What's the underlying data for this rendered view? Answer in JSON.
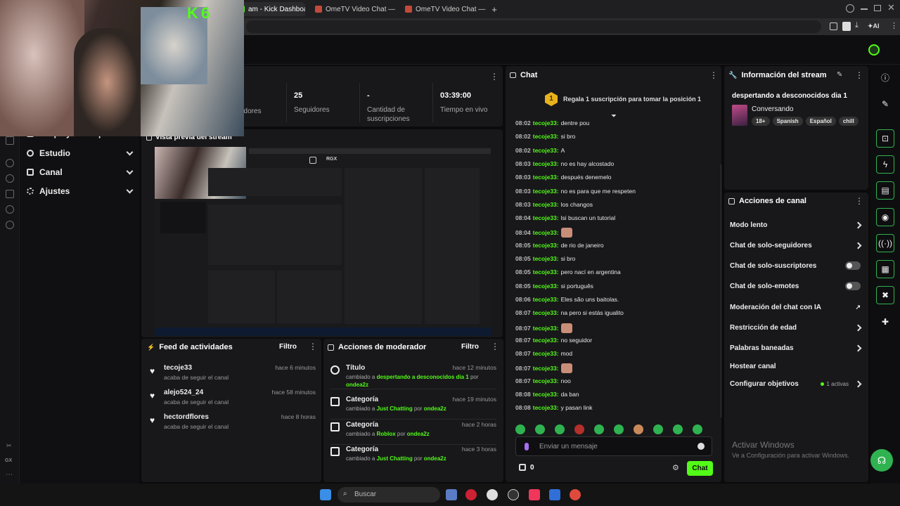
{
  "browser": {
    "tabs": [
      {
        "label": "am - Kick Dashboard",
        "active": true
      },
      {
        "label": "OmeTV Video Chat — Ome",
        "active": false
      },
      {
        "label": "OmeTV Video Chat — Ome",
        "active": false
      }
    ],
    "new_tab": "+",
    "ai_label": "AI"
  },
  "webcam": {
    "logo": "K 6"
  },
  "sidebar": {
    "items": [
      {
        "label": "Drops y recompensas",
        "icon": "gift-icon"
      },
      {
        "label": "Estudio",
        "icon": "studio-icon"
      },
      {
        "label": "Canal",
        "icon": "channel-icon"
      },
      {
        "label": "Ajustes",
        "icon": "settings-icon"
      }
    ],
    "bottom_labels": [
      "GX"
    ]
  },
  "stats": {
    "items": [
      {
        "value": "",
        "label": "adores"
      },
      {
        "value": "25",
        "label": "Seguidores"
      },
      {
        "value": "-",
        "label": "Cantidad de suscripciones"
      },
      {
        "value": "03:39:00",
        "label": "Tiempo en vivo"
      }
    ]
  },
  "preview": {
    "title": "Vista previa del stream",
    "badge": "RGX"
  },
  "feed": {
    "title": "Feed de actividades",
    "filter": "Filtro",
    "items": [
      {
        "name": "tecoje33",
        "sub": "acaba de seguir el canal",
        "time": "hace 6 minutos"
      },
      {
        "name": "alejo524_24",
        "sub": "acaba de seguir el canal",
        "time": "hace 58 minutos"
      },
      {
        "name": "hectordflores",
        "sub": "acaba de seguir el canal",
        "time": "hace 8 horas"
      }
    ]
  },
  "mod": {
    "title": "Acciones de moderador",
    "filter": "Filtro",
    "items": [
      {
        "title": "Título",
        "pre": "cambiado a ",
        "target": "despertando a desconocidos dia 1",
        "mid": " por ",
        "by": "ondea2z",
        "time": "hace 12 minutos"
      },
      {
        "title": "Categoría",
        "pre": "cambiado a ",
        "target": "Just Chatting",
        "mid": " por ",
        "by": "ondea2z",
        "time": "hace 19 minutos"
      },
      {
        "title": "Categoría",
        "pre": "cambiado a ",
        "target": "Roblox",
        "mid": " por ",
        "by": "ondea2z",
        "time": "hace 2 horas"
      },
      {
        "title": "Categoría",
        "pre": "cambiado a ",
        "target": "Just Chatting",
        "mid": " por ",
        "by": "ondea2z",
        "time": "hace 3 horas"
      }
    ]
  },
  "chat": {
    "title": "Chat",
    "sub_rank": "1",
    "sub_banner": "Regala 1 suscripción para tomar la posición 1",
    "messages": [
      {
        "time": "08:02",
        "user": "tecoje33:",
        "text": "dentre pou",
        "emote": false
      },
      {
        "time": "08:02",
        "user": "tecoje33:",
        "text": "si bro",
        "emote": false
      },
      {
        "time": "08:02",
        "user": "tecoje33:",
        "text": "A",
        "emote": false
      },
      {
        "time": "08:03",
        "user": "tecoje33:",
        "text": "no es hay alcostado",
        "emote": false
      },
      {
        "time": "08:03",
        "user": "tecoje33:",
        "text": "después denemelo",
        "emote": false
      },
      {
        "time": "08:03",
        "user": "tecoje33:",
        "text": "no es para que me respeten",
        "emote": false
      },
      {
        "time": "08:03",
        "user": "tecoje33:",
        "text": "los changos",
        "emote": false
      },
      {
        "time": "08:04",
        "user": "tecoje33:",
        "text": "lsi buscan un tutorial",
        "emote": false
      },
      {
        "time": "08:04",
        "user": "tecoje33:",
        "text": "",
        "emote": true
      },
      {
        "time": "08:05",
        "user": "tecoje33:",
        "text": "de rio de janeiro",
        "emote": false
      },
      {
        "time": "08:05",
        "user": "tecoje33:",
        "text": "si bro",
        "emote": false
      },
      {
        "time": "08:05",
        "user": "tecoje33:",
        "text": "pero nací en argentina",
        "emote": false
      },
      {
        "time": "08:05",
        "user": "tecoje33:",
        "text": "si português",
        "emote": false
      },
      {
        "time": "08:06",
        "user": "tecoje33:",
        "text": "Eles são uns baitolas.",
        "emote": false
      },
      {
        "time": "08:07",
        "user": "tecoje33:",
        "text": "na pero si estás igualito",
        "emote": false
      },
      {
        "time": "08:07",
        "user": "tecoje33:",
        "text": "",
        "emote": true
      },
      {
        "time": "08:07",
        "user": "tecoje33:",
        "text": "no seguidor",
        "emote": false
      },
      {
        "time": "08:07",
        "user": "tecoje33:",
        "text": "mod",
        "emote": false
      },
      {
        "time": "08:07",
        "user": "tecoje33:",
        "text": "",
        "emote": true
      },
      {
        "time": "08:07",
        "user": "tecoje33:",
        "text": "noo",
        "emote": false
      },
      {
        "time": "08:08",
        "user": "tecoje33:",
        "text": "da ban",
        "emote": false
      },
      {
        "time": "08:08",
        "user": "tecoje33:",
        "text": "y pasan link",
        "emote": false
      }
    ],
    "input_placeholder": "Enviar un mensaje",
    "points": "0",
    "send_label": "Chat"
  },
  "stream_info": {
    "title": "Información del stream",
    "stream_title": "despertando a desconocidos dia 1",
    "category": "Conversando",
    "tags": [
      "18+",
      "Spanish",
      "Español",
      "chill"
    ]
  },
  "channel_actions": {
    "title": "Acciones de canal",
    "items": [
      {
        "label": "Modo lento",
        "control": "chevron"
      },
      {
        "label": "Chat de solo-seguidores",
        "control": "chevron"
      },
      {
        "label": "Chat de solo-suscriptores",
        "control": "toggle"
      },
      {
        "label": "Chat de solo-emotes",
        "control": "toggle"
      },
      {
        "label": "Moderación del chat con IA",
        "control": "external"
      },
      {
        "label": "Restricción de edad",
        "control": "chevron"
      },
      {
        "label": "Palabras baneadas",
        "control": "chevron"
      },
      {
        "label": "Hostear canal",
        "control": "none"
      },
      {
        "label": "Configurar objetivos",
        "control": "chevron",
        "extra": "1 activas"
      }
    ]
  },
  "watermark": {
    "line1": "Activar Windows",
    "line2": "Ve a Configuración para activar Windows."
  },
  "taskbar": {
    "search_placeholder": "Buscar"
  },
  "colors": {
    "accent": "#53fc18",
    "panel": "#18181b",
    "background": "#0b0b0c"
  }
}
